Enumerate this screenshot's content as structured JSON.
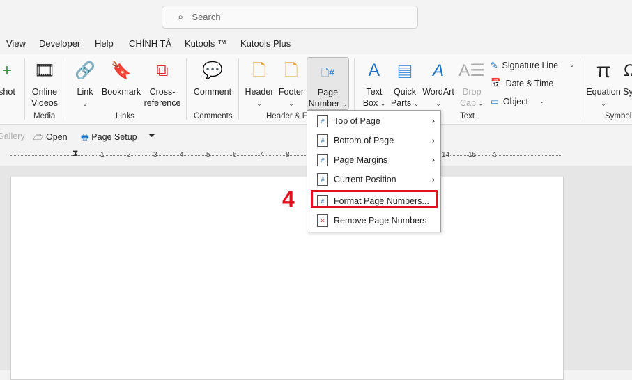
{
  "search": {
    "placeholder": "Search"
  },
  "tabs": [
    "View",
    "Developer",
    "Help",
    "CHÍNH TẢ",
    "Kutools ™",
    "Kutools Plus"
  ],
  "ribbon": {
    "screenshot": "shot",
    "online_videos": [
      "Online",
      "Videos"
    ],
    "link": "Link",
    "bookmark": "Bookmark",
    "cross_ref": [
      "Cross-",
      "reference"
    ],
    "comment": "Comment",
    "header": "Header",
    "footer": "Footer",
    "page_number": [
      "Page",
      "Number"
    ],
    "text_box": [
      "Text",
      "Box"
    ],
    "quick_parts": [
      "Quick",
      "Parts"
    ],
    "wordart": "WordArt",
    "drop_cap": [
      "Drop",
      "Cap"
    ],
    "signature_line": "Signature Line",
    "date_time": "Date & Time",
    "object": "Object",
    "equation": "Equation",
    "symbol": "Sy",
    "groups": {
      "media": "Media",
      "links": "Links",
      "comments": "Comments",
      "header_footer": "Header & F",
      "text": "Text",
      "symbols": "Symbols"
    }
  },
  "quick_access": {
    "gallery": "Gallery",
    "open": "Open",
    "page_setup": "Page Setup"
  },
  "ruler": [
    "1",
    "2",
    "3",
    "4",
    "5",
    "6",
    "7",
    "8",
    "14",
    "15"
  ],
  "menu": {
    "items": [
      "Top of Page",
      "Bottom of Page",
      "Page Margins",
      "Current Position",
      "Format Page Numbers...",
      "Remove Page Numbers"
    ],
    "highlighted": "Format Page Numbers..."
  },
  "step_label": "4",
  "colors": {
    "highlight": "#e3101e",
    "accent": "#1a73c8"
  }
}
